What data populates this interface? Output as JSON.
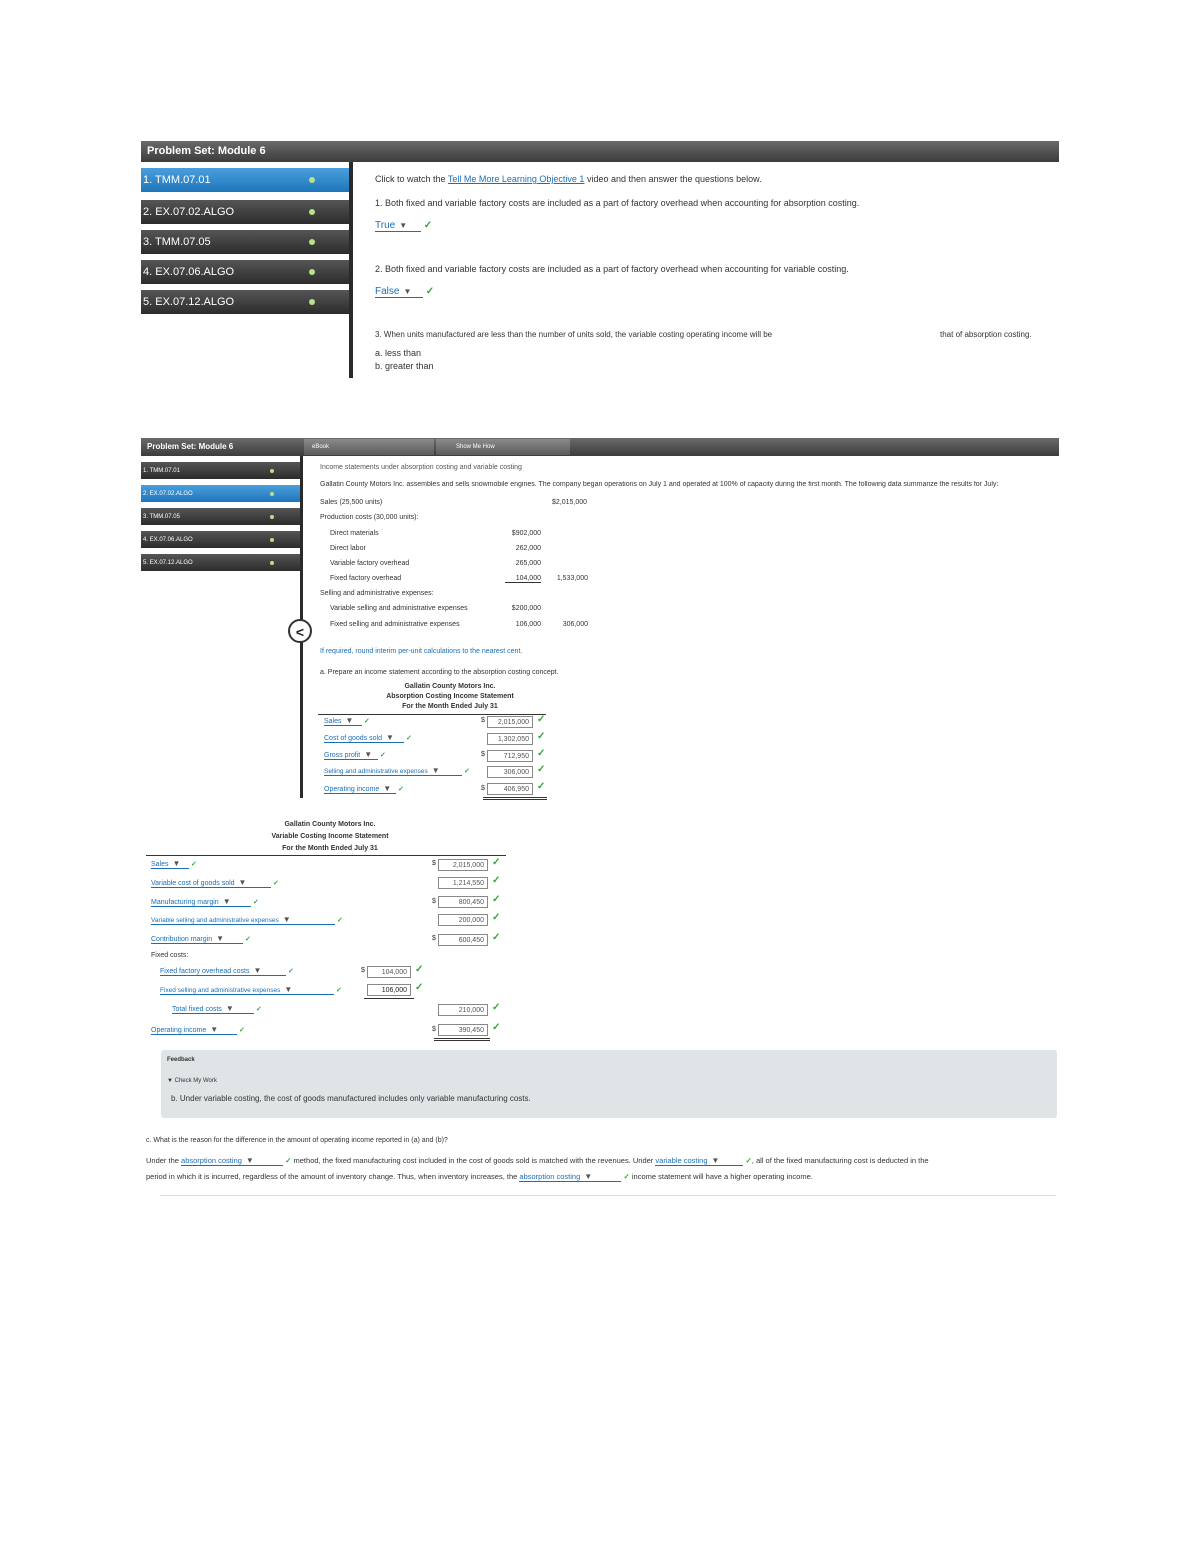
{
  "panel1": {
    "title": "Problem Set: Module 6",
    "nav": [
      {
        "label": "1. TMM.07.01"
      },
      {
        "label": "2. EX.07.02.ALGO"
      },
      {
        "label": "3. TMM.07.05"
      },
      {
        "label": "4. EX.07.06.ALGO"
      },
      {
        "label": "5. EX.07.12.ALGO"
      }
    ],
    "intro_prefix": "Click to watch the",
    "intro_link": "Tell Me More Learning Objective 1",
    "intro_suffix": "video and then answer the questions below.",
    "q1": "1.  Both fixed and variable factory costs are included as a part of factory overhead when accounting for absorption costing.",
    "q1_answer": "True",
    "q2": "2.  Both fixed and variable factory costs are included as a part of factory overhead when accounting for variable costing.",
    "q2_answer": "False",
    "q3_start": "3.  When units manufactured are less than the number of units sold, the variable costing operating income will be",
    "q3_end": "that of absorption costing.",
    "q3_options": [
      "a. less than",
      "b. greater than"
    ]
  },
  "panel2": {
    "title": "Problem Set: Module 6",
    "tabs": [
      "eBook",
      "Show Me How"
    ],
    "nav": [
      {
        "label": "1. TMM.07.01"
      },
      {
        "label": "2. EX.07.02.ALGO"
      },
      {
        "label": "3. TMM.07.05"
      },
      {
        "label": "4. EX.07.06.ALGO"
      },
      {
        "label": "5. EX.07.12.ALGO"
      }
    ],
    "heading": "Income statements under absorption costing and variable costing",
    "description": "Gallatin County Motors Inc. assembles and sells snowmobile engines. The company began operations on July 1 and operated at 100% of capacity during the first month. The following data summarize the results for July:",
    "sales_label": "Sales (25,500 units)",
    "sales_value": "$2,015,000",
    "prod_label": "Production costs (30,000 units):",
    "prod_items": [
      {
        "label": "Direct materials",
        "value": "$902,000"
      },
      {
        "label": "Direct labor",
        "value": "262,000"
      },
      {
        "label": "Variable factory overhead",
        "value": "265,000"
      },
      {
        "label": "Fixed factory overhead",
        "value": "104,000",
        "total": "1,533,000"
      }
    ],
    "sell_label": "Selling and administrative expenses:",
    "sell_items": [
      {
        "label": "Variable selling and administrative expenses",
        "value": "$200,000"
      },
      {
        "label": "Fixed selling and administrative expenses",
        "value": "106,000",
        "total": "306,000"
      }
    ],
    "required": "If required, round interim per-unit calculations to the nearest cent.",
    "part_a": "a.  Prepare an income statement according to the absorption costing concept.",
    "stmt_title1": "Gallatin County Motors Inc.",
    "stmt_title2": "Absorption Costing Income Statement",
    "stmt_title3": "For the Month Ended July 31",
    "rows": [
      {
        "label": "Sales",
        "value": "2,015,000",
        "dollar": "$"
      },
      {
        "label": "Cost of goods sold",
        "value": "1,302,050",
        "dollar": ""
      },
      {
        "label": "Gross profit",
        "value": "712,950",
        "dollar": "$"
      },
      {
        "label": "Selling and administrative expenses",
        "value": "306,000",
        "dollar": ""
      },
      {
        "label": "Operating income",
        "value": "406,950",
        "dollar": "$"
      }
    ]
  },
  "panel3": {
    "title1": "Gallatin County Motors Inc.",
    "title2": "Variable Costing Income Statement",
    "title3": "For the Month Ended July 31",
    "rows": [
      {
        "label": "Sales",
        "value": "2,015,000",
        "dollar": "$"
      },
      {
        "label": "Variable cost of goods sold",
        "value": "1,214,550",
        "dollar": ""
      },
      {
        "label": "Manufacturing margin",
        "value": "800,450",
        "dollar": "$"
      },
      {
        "label": "Variable selling and administrative expenses",
        "value": "200,000",
        "dollar": ""
      },
      {
        "label": "Contribution margin",
        "value": "600,450",
        "dollar": "$"
      }
    ],
    "fixed_label": "Fixed costs:",
    "fixed_rows": [
      {
        "label": "Fixed factory overhead costs",
        "value": "104,000",
        "dollar": "$"
      },
      {
        "label": "Fixed selling and administrative expenses",
        "value": "106,000",
        "dollar": ""
      }
    ],
    "total_fixed_label": "Total fixed costs",
    "total_fixed_value": "210,000",
    "op_income_label": "Operating income",
    "op_income_value": "390,450",
    "feedback_label": "Feedback",
    "feedback_sub": "▼ Check My Work",
    "feedback_text": "b. Under variable costing, the cost of goods manufactured includes only variable manufacturing costs.",
    "part_c": "c.  What is the reason for the difference in the amount of operating income reported in (a) and (b)?",
    "c_1": "Under the",
    "c_sel1": "absorption costing",
    "c_2": "method, the fixed manufacturing cost included in the cost of goods sold is matched with the revenues. Under",
    "c_sel2": "variable costing",
    "c_3": ", all of the fixed manufacturing cost is deducted in the",
    "c_4": "period in which it is incurred, regardless of the amount of inventory change. Thus, when inventory increases, the",
    "c_sel3": "absorption costing",
    "c_5": "income statement will have a higher operating income."
  },
  "colors": {
    "accent": "#1a6fb8",
    "check": "#35a63c",
    "active_nav": "#2a84c8"
  }
}
